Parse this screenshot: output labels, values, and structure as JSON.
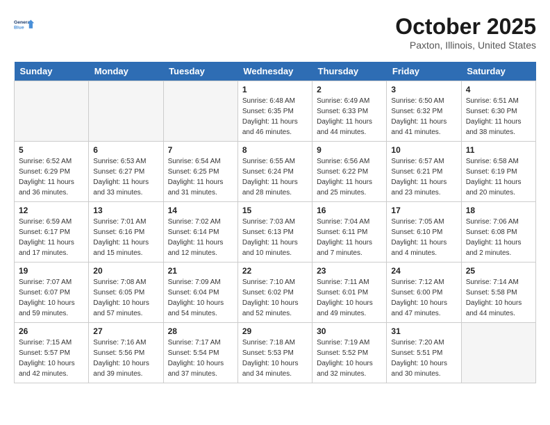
{
  "logo": {
    "line1": "General",
    "line2": "Blue"
  },
  "title": "October 2025",
  "location": "Paxton, Illinois, United States",
  "weekdays": [
    "Sunday",
    "Monday",
    "Tuesday",
    "Wednesday",
    "Thursday",
    "Friday",
    "Saturday"
  ],
  "weeks": [
    [
      {
        "day": "",
        "empty": true
      },
      {
        "day": "",
        "empty": true
      },
      {
        "day": "",
        "empty": true
      },
      {
        "day": "1",
        "sunrise": "6:48 AM",
        "sunset": "6:35 PM",
        "daylight": "11 hours and 46 minutes."
      },
      {
        "day": "2",
        "sunrise": "6:49 AM",
        "sunset": "6:33 PM",
        "daylight": "11 hours and 44 minutes."
      },
      {
        "day": "3",
        "sunrise": "6:50 AM",
        "sunset": "6:32 PM",
        "daylight": "11 hours and 41 minutes."
      },
      {
        "day": "4",
        "sunrise": "6:51 AM",
        "sunset": "6:30 PM",
        "daylight": "11 hours and 38 minutes."
      }
    ],
    [
      {
        "day": "5",
        "sunrise": "6:52 AM",
        "sunset": "6:29 PM",
        "daylight": "11 hours and 36 minutes."
      },
      {
        "day": "6",
        "sunrise": "6:53 AM",
        "sunset": "6:27 PM",
        "daylight": "11 hours and 33 minutes."
      },
      {
        "day": "7",
        "sunrise": "6:54 AM",
        "sunset": "6:25 PM",
        "daylight": "11 hours and 31 minutes."
      },
      {
        "day": "8",
        "sunrise": "6:55 AM",
        "sunset": "6:24 PM",
        "daylight": "11 hours and 28 minutes."
      },
      {
        "day": "9",
        "sunrise": "6:56 AM",
        "sunset": "6:22 PM",
        "daylight": "11 hours and 25 minutes."
      },
      {
        "day": "10",
        "sunrise": "6:57 AM",
        "sunset": "6:21 PM",
        "daylight": "11 hours and 23 minutes."
      },
      {
        "day": "11",
        "sunrise": "6:58 AM",
        "sunset": "6:19 PM",
        "daylight": "11 hours and 20 minutes."
      }
    ],
    [
      {
        "day": "12",
        "sunrise": "6:59 AM",
        "sunset": "6:17 PM",
        "daylight": "11 hours and 17 minutes."
      },
      {
        "day": "13",
        "sunrise": "7:01 AM",
        "sunset": "6:16 PM",
        "daylight": "11 hours and 15 minutes."
      },
      {
        "day": "14",
        "sunrise": "7:02 AM",
        "sunset": "6:14 PM",
        "daylight": "11 hours and 12 minutes."
      },
      {
        "day": "15",
        "sunrise": "7:03 AM",
        "sunset": "6:13 PM",
        "daylight": "11 hours and 10 minutes."
      },
      {
        "day": "16",
        "sunrise": "7:04 AM",
        "sunset": "6:11 PM",
        "daylight": "11 hours and 7 minutes."
      },
      {
        "day": "17",
        "sunrise": "7:05 AM",
        "sunset": "6:10 PM",
        "daylight": "11 hours and 4 minutes."
      },
      {
        "day": "18",
        "sunrise": "7:06 AM",
        "sunset": "6:08 PM",
        "daylight": "11 hours and 2 minutes."
      }
    ],
    [
      {
        "day": "19",
        "sunrise": "7:07 AM",
        "sunset": "6:07 PM",
        "daylight": "10 hours and 59 minutes."
      },
      {
        "day": "20",
        "sunrise": "7:08 AM",
        "sunset": "6:05 PM",
        "daylight": "10 hours and 57 minutes."
      },
      {
        "day": "21",
        "sunrise": "7:09 AM",
        "sunset": "6:04 PM",
        "daylight": "10 hours and 54 minutes."
      },
      {
        "day": "22",
        "sunrise": "7:10 AM",
        "sunset": "6:02 PM",
        "daylight": "10 hours and 52 minutes."
      },
      {
        "day": "23",
        "sunrise": "7:11 AM",
        "sunset": "6:01 PM",
        "daylight": "10 hours and 49 minutes."
      },
      {
        "day": "24",
        "sunrise": "7:12 AM",
        "sunset": "6:00 PM",
        "daylight": "10 hours and 47 minutes."
      },
      {
        "day": "25",
        "sunrise": "7:14 AM",
        "sunset": "5:58 PM",
        "daylight": "10 hours and 44 minutes."
      }
    ],
    [
      {
        "day": "26",
        "sunrise": "7:15 AM",
        "sunset": "5:57 PM",
        "daylight": "10 hours and 42 minutes."
      },
      {
        "day": "27",
        "sunrise": "7:16 AM",
        "sunset": "5:56 PM",
        "daylight": "10 hours and 39 minutes."
      },
      {
        "day": "28",
        "sunrise": "7:17 AM",
        "sunset": "5:54 PM",
        "daylight": "10 hours and 37 minutes."
      },
      {
        "day": "29",
        "sunrise": "7:18 AM",
        "sunset": "5:53 PM",
        "daylight": "10 hours and 34 minutes."
      },
      {
        "day": "30",
        "sunrise": "7:19 AM",
        "sunset": "5:52 PM",
        "daylight": "10 hours and 32 minutes."
      },
      {
        "day": "31",
        "sunrise": "7:20 AM",
        "sunset": "5:51 PM",
        "daylight": "10 hours and 30 minutes."
      },
      {
        "day": "",
        "empty": true
      }
    ]
  ]
}
